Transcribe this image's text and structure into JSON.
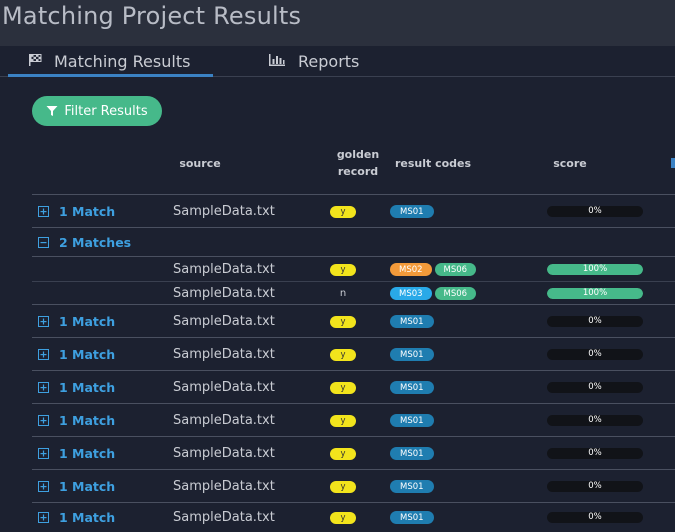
{
  "header": {
    "title": "Matching Project Results"
  },
  "tabs": [
    {
      "label": "Matching Results",
      "icon": "flag-checkered-icon"
    },
    {
      "label": "Reports",
      "icon": "bar-chart-icon"
    }
  ],
  "filter": {
    "label": "Filter Results",
    "icon": "filter-icon"
  },
  "columns": {
    "source": "source",
    "golden_line1": "golden",
    "golden_line2": "record",
    "codes": "result codes",
    "score": "score"
  },
  "colors": {
    "accent": "#3ea0e0",
    "green": "#46b98a",
    "yellow": "#f2e41c",
    "orange": "#f29a3a",
    "ms01": "#1f7db0",
    "ms03": "#29a9e8"
  },
  "rows": [
    {
      "type": "group",
      "expanded": false,
      "label": "1 Match",
      "source": "SampleData.txt",
      "golden": "y",
      "codes": [
        "MS01"
      ],
      "score_label": "0%",
      "score": 0
    },
    {
      "type": "group",
      "expanded": true,
      "label": "2 Matches"
    },
    {
      "type": "child",
      "source": "SampleData.txt",
      "golden": "y",
      "codes": [
        "MS02",
        "MS06"
      ],
      "score_label": "100%",
      "score": 100
    },
    {
      "type": "child",
      "source": "SampleData.txt",
      "golden": "n",
      "codes": [
        "MS03",
        "MS06"
      ],
      "score_label": "100%",
      "score": 100
    },
    {
      "type": "group",
      "expanded": false,
      "label": "1 Match",
      "source": "SampleData.txt",
      "golden": "y",
      "codes": [
        "MS01"
      ],
      "score_label": "0%",
      "score": 0
    },
    {
      "type": "group",
      "expanded": false,
      "label": "1 Match",
      "source": "SampleData.txt",
      "golden": "y",
      "codes": [
        "MS01"
      ],
      "score_label": "0%",
      "score": 0
    },
    {
      "type": "group",
      "expanded": false,
      "label": "1 Match",
      "source": "SampleData.txt",
      "golden": "y",
      "codes": [
        "MS01"
      ],
      "score_label": "0%",
      "score": 0
    },
    {
      "type": "group",
      "expanded": false,
      "label": "1 Match",
      "source": "SampleData.txt",
      "golden": "y",
      "codes": [
        "MS01"
      ],
      "score_label": "0%",
      "score": 0
    },
    {
      "type": "group",
      "expanded": false,
      "label": "1 Match",
      "source": "SampleData.txt",
      "golden": "y",
      "codes": [
        "MS01"
      ],
      "score_label": "0%",
      "score": 0
    },
    {
      "type": "group",
      "expanded": false,
      "label": "1 Match",
      "source": "SampleData.txt",
      "golden": "y",
      "codes": [
        "MS01"
      ],
      "score_label": "0%",
      "score": 0
    },
    {
      "type": "group",
      "expanded": false,
      "label": "1 Match",
      "source": "SampleData.txt",
      "golden": "y",
      "codes": [
        "MS01"
      ],
      "score_label": "0%",
      "score": 0
    }
  ]
}
